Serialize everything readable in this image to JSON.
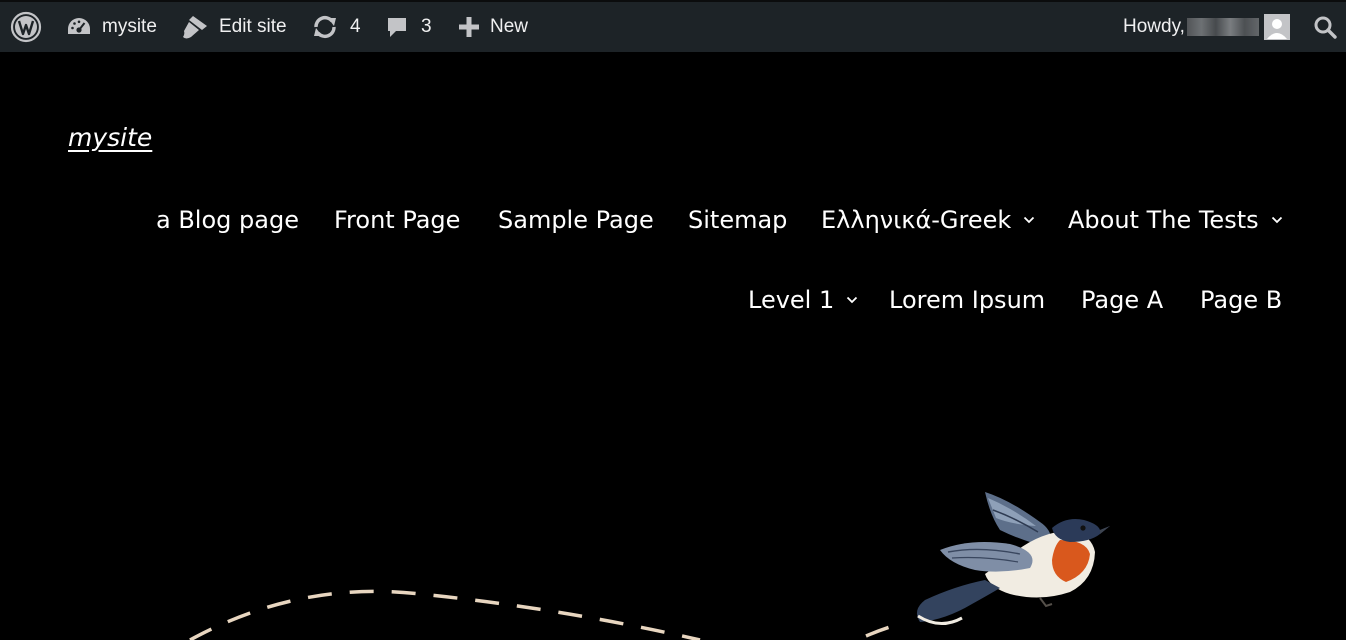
{
  "admin_bar": {
    "site_name": "mysite",
    "edit_site_label": "Edit site",
    "updates_count": "4",
    "comments_count": "3",
    "new_label": "New",
    "greeting": "Howdy,"
  },
  "site": {
    "title": "mysite"
  },
  "nav": {
    "row1": [
      {
        "label": "a Blog page"
      },
      {
        "label": "Front Page"
      },
      {
        "label": "Sample Page"
      },
      {
        "label": "Sitemap"
      },
      {
        "label": "Ελληνικά-Greek",
        "has_submenu": true
      },
      {
        "label": "About The Tests",
        "has_submenu": true
      }
    ],
    "row2": [
      {
        "label": "Level 1",
        "has_submenu": true
      },
      {
        "label": "Lorem Ipsum"
      },
      {
        "label": "Page A"
      },
      {
        "label": "Page B"
      }
    ]
  },
  "icons": {
    "wordpress": "wordpress-logo-icon",
    "dashboard": "dashboard-gauge-icon",
    "edit": "brush-icon",
    "updates": "updates-refresh-icon",
    "comments": "comment-bubble-icon",
    "new": "plus-icon",
    "search": "search-icon",
    "submenu": "chevron-down-icon"
  },
  "colors": {
    "admin_bar_bg": "#1d2327",
    "admin_bar_text": "#f0f0f1",
    "page_bg": "#000000",
    "nav_text": "#ffffff",
    "dash_line": "#e8d6c0"
  }
}
